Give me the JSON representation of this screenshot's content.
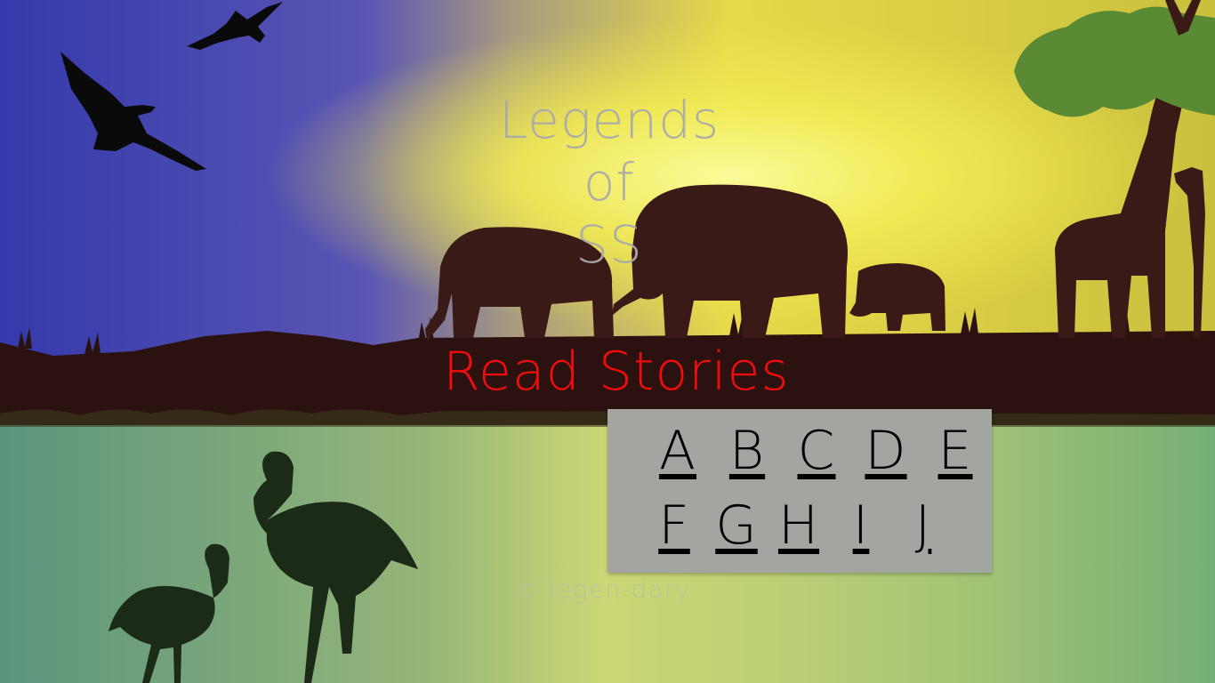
{
  "title": {
    "line1": "Legends",
    "line2": "of",
    "line3": "SS"
  },
  "read_stories_label": "Read Stories",
  "letters": {
    "row1": [
      "A",
      "B",
      "C",
      "D",
      "E"
    ],
    "row2": [
      "F",
      "G",
      "H",
      "I",
      "J"
    ]
  },
  "copyright": "© legen-dary",
  "colors": {
    "sky_blue": "#3b3fae",
    "sun_yellow": "#f4ef3c",
    "title_gray": "#a9abaa",
    "read_red": "#f20d0d",
    "panel_gray": "#a3a5a1",
    "silhouette": "#2a1210"
  }
}
